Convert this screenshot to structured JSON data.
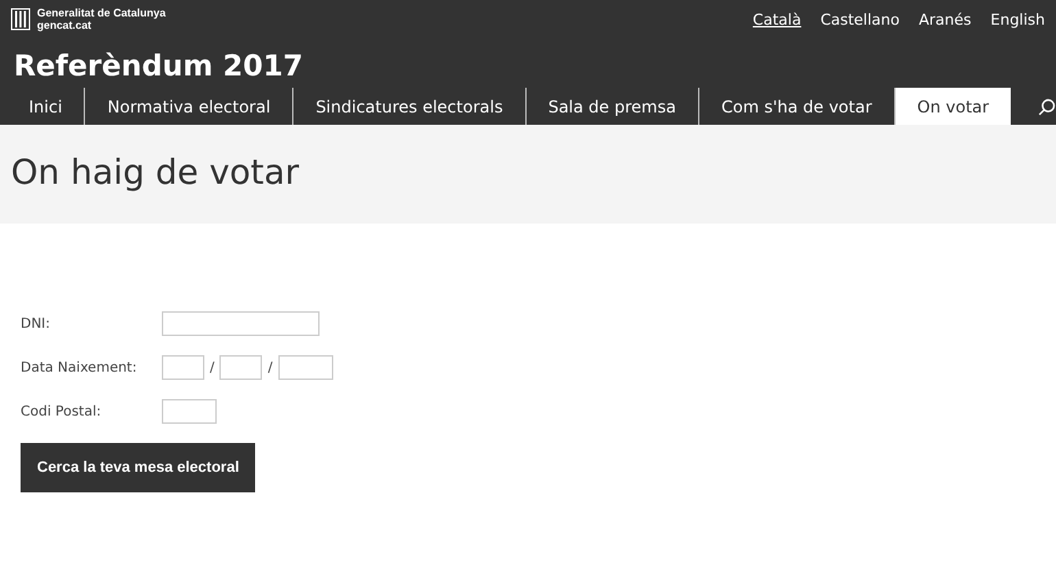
{
  "brand": {
    "name": "Generalitat de Catalunya",
    "site": "gencat.cat"
  },
  "languages": [
    {
      "label": "Català",
      "selected": true
    },
    {
      "label": "Castellano",
      "selected": false
    },
    {
      "label": "Aranés",
      "selected": false
    },
    {
      "label": "English",
      "selected": false
    }
  ],
  "site_title": "Referèndum 2017",
  "nav": [
    {
      "label": "Inici",
      "selected": false
    },
    {
      "label": "Normativa electoral",
      "selected": false
    },
    {
      "label": "Sindicatures electorals",
      "selected": false
    },
    {
      "label": "Sala de premsa",
      "selected": false
    },
    {
      "label": "Com s'ha de votar",
      "selected": false
    },
    {
      "label": "On votar",
      "selected": true
    }
  ],
  "page_title": "On haig de votar",
  "form": {
    "fields": [
      {
        "kind": "text",
        "label": "DNI:"
      },
      {
        "kind": "date",
        "label": "Data Naixement:",
        "separator": "/"
      },
      {
        "kind": "postal",
        "label": "Codi Postal:"
      }
    ],
    "submit": "Cerca la teva mesa electoral"
  }
}
